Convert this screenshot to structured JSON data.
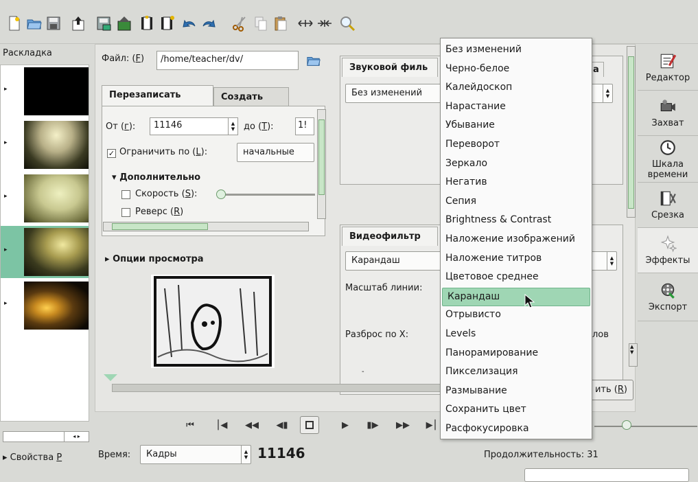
{
  "toolbar": {
    "icons": [
      "new-project-icon",
      "open-folder-icon",
      "save-icon",
      "export-icon",
      "save-as-icon",
      "publish-icon",
      "insert-clip-icon",
      "append-clip-icon",
      "undo-icon",
      "redo-icon",
      "cut-icon",
      "copy-icon",
      "paste-icon",
      "expand-icon",
      "contract-icon",
      "zoom-icon"
    ]
  },
  "storyboard": {
    "title": "Раскладка",
    "properties_label": "Свойства",
    "properties_key": "Р"
  },
  "file": {
    "label_prefix": "Файл: (",
    "label_key": "F",
    "label_suffix": ")",
    "path": "/home/teacher/dv/"
  },
  "tabs": {
    "overwrite": "Перезаписать",
    "create": "Создать"
  },
  "range": {
    "from_prefix": "От (",
    "from_key": "г",
    "from_suffix": "):",
    "from_value": "11146",
    "to_prefix": "до (",
    "to_key": "Т",
    "to_suffix": "):",
    "to_value": "1!",
    "limit_prefix": "Ограничить по (",
    "limit_key": "L",
    "limit_suffix": "):",
    "limit_value": "начальные"
  },
  "advanced": {
    "title": "Дополнительно",
    "speed_prefix": "Скорость (",
    "speed_key": "S",
    "speed_suffix": "):",
    "reverse_prefix": "Реверс (",
    "reverse_key": "R",
    "reverse_suffix": ")"
  },
  "preview": {
    "options_label": "Опции просмотра"
  },
  "audio_filter": {
    "title": "Звуковой филь",
    "value": "Без изменений",
    "tail": "а"
  },
  "video_filter": {
    "title": "Видеофильтр",
    "value": "Карандаш",
    "line_scale_label": "Масштаб линии:",
    "spread_x_label": "Разброс по X:",
    "right_text": "лов",
    "apply_label": "ить (",
    "apply_key": "R",
    "apply_suffix": ")"
  },
  "filter_menu": {
    "items": [
      "Без изменений",
      "Черно-белое",
      "Калейдоскоп",
      "Нарастание",
      "Убывание",
      "Переворот",
      "Зеркало",
      "Негатив",
      "Сепия",
      "Brightness & Contrast",
      "Наложение изображений",
      "Наложение титров",
      "Цветовое среднее",
      "Карандаш",
      "Отрывисто",
      "Levels",
      "Панорамирование",
      "Пикселизация",
      "Размывание",
      "Сохранить цвет",
      "Расфокусировка"
    ],
    "selected_index": 13
  },
  "sidebar": {
    "items": [
      {
        "label": "Редактор"
      },
      {
        "label": "Захват"
      },
      {
        "label": "Шкала времени"
      },
      {
        "label": "Срезка"
      },
      {
        "label": "Эффекты"
      },
      {
        "label": "Экспорт"
      }
    ],
    "active_index": 4
  },
  "bottom": {
    "time_label": "Время:",
    "time_mode": "Кадры",
    "frame": "11146",
    "duration": "Продолжительность: 31"
  },
  "colors": {
    "selection": "#9fd6b4",
    "thumb_selected": "#7cc4a4"
  }
}
